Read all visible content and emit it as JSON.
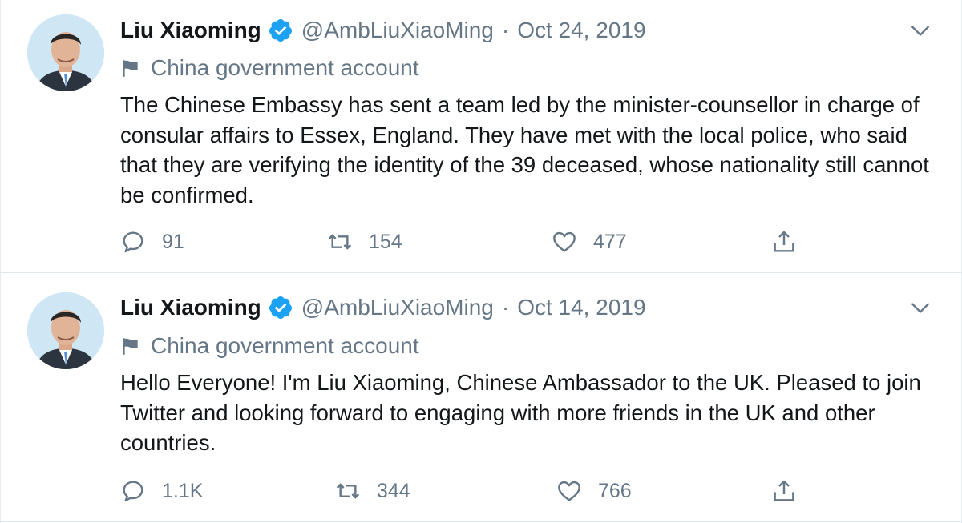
{
  "colors": {
    "verified": "#1da1f2",
    "secondary_text": "#657786",
    "primary_text": "#14171a"
  },
  "tweets": [
    {
      "name": "Liu Xiaoming",
      "handle": "@AmbLiuXiaoMing",
      "separator": "·",
      "date": "Oct 24, 2019",
      "label": "China government account",
      "text": "The Chinese Embassy has sent a team led by the minister-counsellor in charge of consular affairs to Essex, England. They have met with the local police, who said that they are verifying the identity of the 39 deceased, whose nationality still cannot be confirmed.",
      "replies": "91",
      "retweets": "154",
      "likes": "477"
    },
    {
      "name": "Liu Xiaoming",
      "handle": "@AmbLiuXiaoMing",
      "separator": "·",
      "date": "Oct 14, 2019",
      "label": "China government account",
      "text": "Hello Everyone! I'm Liu Xiaoming, Chinese Ambassador to the UK. Pleased to join Twitter and looking forward to engaging with more friends in the UK and other countries.",
      "replies": "1.1K",
      "retweets": "344",
      "likes": "766"
    }
  ],
  "icons": {
    "verified": "verified-badge-icon",
    "caret": "chevron-down-icon",
    "flag": "flag-icon",
    "reply": "reply-icon",
    "retweet": "retweet-icon",
    "like": "heart-icon",
    "share": "share-icon"
  }
}
